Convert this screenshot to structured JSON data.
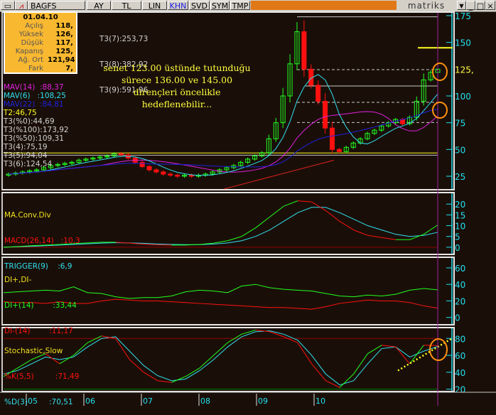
{
  "toolbar": {
    "symbol": "BAGFS",
    "buttons": [
      "AY",
      "TL",
      "LIN",
      "KHN",
      "SVD",
      "SYM",
      "TMP"
    ],
    "brand": "matriks"
  },
  "info_box": {
    "date": "01.04.10",
    "rows": [
      {
        "label": "Açılış",
        "value": "118,"
      },
      {
        "label": "Yüksek",
        "value": "126,"
      },
      {
        "label": "Düşük",
        "value": "117,"
      },
      {
        "label": "Kapanış",
        "value": "125,"
      },
      {
        "label": "Ağ. Ort",
        "value": "121,94"
      },
      {
        "label": "Fark",
        "value": "7,"
      }
    ]
  },
  "legend_main": [
    "MAV(14)  :88,37",
    "MAV(6)   :108,25",
    "MAV(22)  :84,81",
    "T2:46,75",
    "T3(%0):44,69",
    "T3(%100):173,92",
    "T3(%50):109,31",
    "T3(4):75,19",
    "T3(5):94,04",
    "T3(6):124,54"
  ],
  "legend_t3": [
    "T3(7):253,73",
    "T3(8):382,92",
    "T3(9):591,96"
  ],
  "annotation": "senet 123.00 üstünde tutunduğu sürece 136.00 ve 145.00 dirençleri öncelikle hedeflenebilir...",
  "colors": {
    "up": "#20ff20",
    "down": "#ff1010",
    "mav14": "#e020e0",
    "mav6": "#30e0f0",
    "mav22": "#2020e0",
    "axis": "#20e0f0",
    "support": "#ffff20",
    "circle": "#ff9010"
  },
  "chart_data": [
    {
      "type": "candlestick",
      "title": "BAGFS",
      "ylim": [
        15,
        180
      ],
      "yticks": [
        25,
        50,
        75,
        100,
        125,
        150,
        175
      ],
      "current_label": "125,",
      "xticks": [
        "05",
        "06",
        "07",
        "08",
        "09",
        "10"
      ],
      "closes": [
        27,
        28,
        29,
        30,
        31,
        33,
        35,
        36,
        37,
        38,
        40,
        41,
        42,
        43,
        44,
        46,
        45,
        42,
        38,
        34,
        31,
        29,
        27,
        26,
        25,
        26,
        25,
        26,
        27,
        29,
        31,
        33,
        35,
        38,
        41,
        44,
        47,
        60,
        75,
        100,
        130,
        160,
        125,
        110,
        95,
        70,
        50,
        48,
        52,
        56,
        60,
        65,
        68,
        72,
        75,
        78,
        74,
        80,
        95,
        115,
        122,
        125
      ],
      "levels": {
        "support_T2": 46.75,
        "T3_0": 44.69,
        "T3_100": 173.92,
        "T3_50": 109.31,
        "T3_4": 75.19,
        "T3_5": 94.04,
        "T3_6": 124.54,
        "resistance": 145
      }
    },
    {
      "type": "line",
      "title": "MA.Conv.Div",
      "ylim": [
        -3,
        25
      ],
      "yticks": [
        0,
        5,
        10,
        15,
        20
      ],
      "series": [
        {
          "name": "MACD(26,14)",
          "last": "10,3",
          "values": [
            0,
            0.3,
            0.7,
            1,
            1.3,
            1.7,
            2,
            2.3,
            2.3,
            1.9,
            1.4,
            1.1,
            1,
            1,
            1.3,
            1.9,
            3,
            5,
            9,
            14,
            19,
            21.5,
            21,
            17,
            12,
            8,
            5.5,
            4.5,
            3.5,
            3.5,
            6,
            10.3
          ]
        },
        {
          "name": "TRIGGER(9)",
          "last": "6,9",
          "values": [
            0,
            0.2,
            0.4,
            0.7,
            1,
            1.3,
            1.6,
            1.9,
            2.1,
            2,
            1.8,
            1.5,
            1.3,
            1.2,
            1.2,
            1.5,
            2,
            3,
            5,
            8,
            12,
            16,
            18.5,
            18.5,
            16,
            13,
            10,
            8,
            6,
            5,
            5.5,
            6.9
          ]
        }
      ]
    },
    {
      "type": "line",
      "title": "DI+,DI-",
      "ylim": [
        -8,
        72
      ],
      "yticks": [
        0,
        20,
        40,
        60
      ],
      "series": [
        {
          "name": "DI+(14)",
          "last": "33,44",
          "values": [
            30,
            31,
            32,
            33,
            32,
            37,
            30,
            29,
            25,
            23,
            24,
            24,
            26,
            31,
            33,
            32,
            30,
            38,
            40,
            36,
            34,
            33,
            32,
            29,
            26,
            25,
            27,
            26,
            28,
            33,
            35,
            33.4
          ]
        },
        {
          "name": "DI-(14)",
          "last": "11,17",
          "values": [
            19,
            18,
            18,
            17,
            19,
            17,
            17,
            20,
            22,
            21,
            20,
            20,
            19,
            18,
            17,
            16,
            15,
            14,
            13,
            12,
            12,
            11,
            10,
            13,
            17,
            19,
            21,
            20,
            20,
            18,
            14,
            11.2
          ]
        }
      ]
    },
    {
      "type": "line",
      "title": "Stochastic,Slow",
      "ylim": [
        18,
        92
      ],
      "yticks": [
        20,
        40,
        60,
        80
      ],
      "series": [
        {
          "name": "%K(5,5)",
          "last": "71,49",
          "values": [
            35,
            45,
            55,
            62,
            50,
            60,
            75,
            83,
            80,
            55,
            40,
            30,
            28,
            35,
            45,
            60,
            75,
            85,
            90,
            88,
            82,
            75,
            50,
            30,
            22,
            38,
            62,
            72,
            70,
            50,
            72,
            71.5
          ]
        },
        {
          "name": "%D(3)",
          "last": "70,51",
          "values": [
            38,
            42,
            50,
            58,
            55,
            58,
            70,
            80,
            82,
            65,
            48,
            36,
            30,
            32,
            42,
            55,
            70,
            82,
            88,
            89,
            85,
            78,
            60,
            38,
            25,
            30,
            50,
            68,
            70,
            58,
            65,
            70.5
          ]
        }
      ]
    }
  ]
}
